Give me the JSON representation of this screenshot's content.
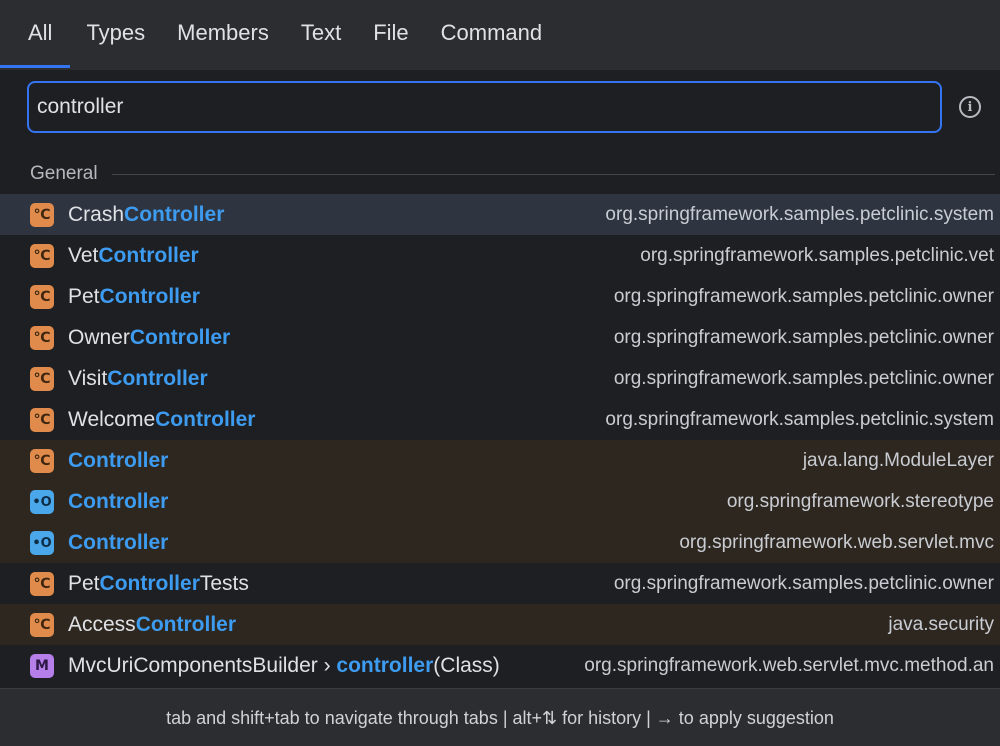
{
  "tabs": [
    "All",
    "Types",
    "Members",
    "Text",
    "File",
    "Command"
  ],
  "search": {
    "value": "controller"
  },
  "info_icon": "info-icon",
  "section": {
    "label": "General"
  },
  "results": [
    {
      "icon": "class-icon",
      "icon_glyph": "℃",
      "prefix": "Crash",
      "match": "Controller",
      "suffix": "",
      "location": "org.springframework.samples.petclinic.system",
      "state": "selected"
    },
    {
      "icon": "class-icon",
      "icon_glyph": "℃",
      "prefix": "Vet",
      "match": "Controller",
      "suffix": "",
      "location": "org.springframework.samples.petclinic.vet",
      "state": "normal"
    },
    {
      "icon": "class-icon",
      "icon_glyph": "℃",
      "prefix": "Pet",
      "match": "Controller",
      "suffix": "",
      "location": "org.springframework.samples.petclinic.owner",
      "state": "normal"
    },
    {
      "icon": "class-icon",
      "icon_glyph": "℃",
      "prefix": "Owner",
      "match": "Controller",
      "suffix": "",
      "location": "org.springframework.samples.petclinic.owner",
      "state": "normal"
    },
    {
      "icon": "class-icon",
      "icon_glyph": "℃",
      "prefix": "Visit",
      "match": "Controller",
      "suffix": "",
      "location": "org.springframework.samples.petclinic.owner",
      "state": "normal"
    },
    {
      "icon": "class-icon",
      "icon_glyph": "℃",
      "prefix": "Welcome",
      "match": "Controller",
      "suffix": "",
      "location": "org.springframework.samples.petclinic.system",
      "state": "normal"
    },
    {
      "icon": "class-icon",
      "icon_glyph": "℃",
      "prefix": "",
      "match": "Controller",
      "suffix": "",
      "location": "java.lang.ModuleLayer",
      "state": "library"
    },
    {
      "icon": "annotation-icon",
      "icon_glyph": "•O",
      "prefix": "",
      "match": "Controller",
      "suffix": "",
      "location": "org.springframework.stereotype",
      "state": "library"
    },
    {
      "icon": "annotation-icon",
      "icon_glyph": "•O",
      "prefix": "",
      "match": "Controller",
      "suffix": "",
      "location": "org.springframework.web.servlet.mvc",
      "state": "library"
    },
    {
      "icon": "class-icon",
      "icon_glyph": "℃",
      "prefix": "Pet",
      "match": "Controller",
      "suffix": "Tests",
      "location": "org.springframework.samples.petclinic.owner",
      "state": "normal"
    },
    {
      "icon": "class-icon",
      "icon_glyph": "℃",
      "prefix": "Access",
      "match": "Controller",
      "suffix": "",
      "location": "java.security",
      "state": "library"
    },
    {
      "icon": "method-icon",
      "icon_glyph": "M",
      "prefix": "MvcUriComponentsBuilder › ",
      "match": "controller",
      "suffix": "(Class)",
      "location": "org.springframework.web.servlet.mvc.method.an",
      "state": "normal"
    }
  ],
  "footer": {
    "hint": "tab and shift+tab to navigate through tabs  |  alt+⇅ for history  |  → to apply suggestion"
  },
  "colors": {
    "accent": "#3574f0",
    "match_highlight": "#3d9bf0",
    "class_icon": "#e08b4b",
    "annotation_icon": "#4aa8ea",
    "method_icon": "#b57ee8",
    "selected_row": "#2e3440",
    "library_row": "#2d2720"
  }
}
